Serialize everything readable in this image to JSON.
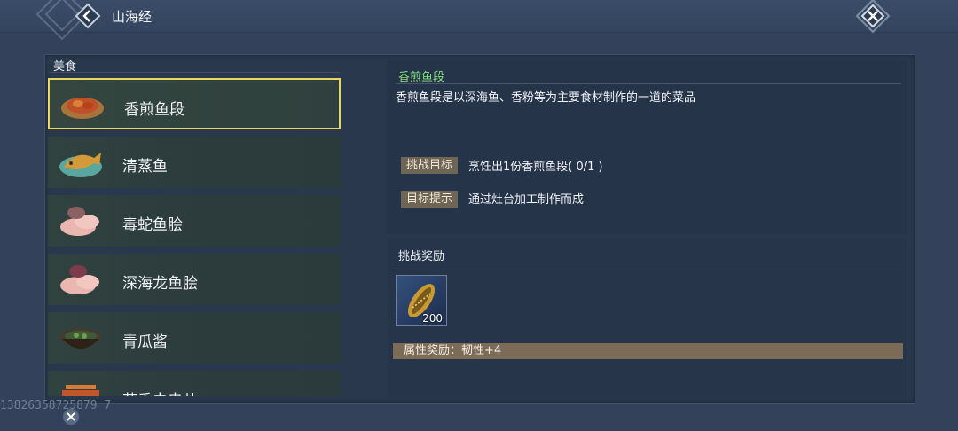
{
  "header": {
    "title": "山海经"
  },
  "category": {
    "label": "美食"
  },
  "foods": [
    {
      "name": "香煎鱼段",
      "icon": "fried-fish-icon",
      "selected": true
    },
    {
      "name": "清蒸鱼",
      "icon": "steamed-fish-icon",
      "selected": false
    },
    {
      "name": "毒蛇鱼脍",
      "icon": "sashimi-icon",
      "selected": false
    },
    {
      "name": "深海龙鱼脍",
      "icon": "sashimi-icon",
      "selected": false
    },
    {
      "name": "青瓜酱",
      "icon": "bowl-icon",
      "selected": false
    },
    {
      "name": "茴香虫串儿",
      "icon": "skewer-icon",
      "selected": false
    }
  ],
  "detail": {
    "title": "香煎鱼段",
    "description": "香煎鱼段是以深海鱼、香粉等为主要食材制作的一道的菜品",
    "goal_tag": "挑战目标",
    "goal_text": "烹饪出1份香煎鱼段( 0/1 )",
    "hint_tag": "目标提示",
    "hint_text": "通过灶台加工制作而成"
  },
  "reward": {
    "title": "挑战奖励",
    "item_count": "200",
    "item_icon": "golden-shell-icon",
    "attr_text": "属性奖励：韧性+4"
  },
  "watermark": "13826358725879 7",
  "colors": {
    "highlight": "#e7d660",
    "title_green": "#86e07a",
    "tag": "#6e6555"
  }
}
